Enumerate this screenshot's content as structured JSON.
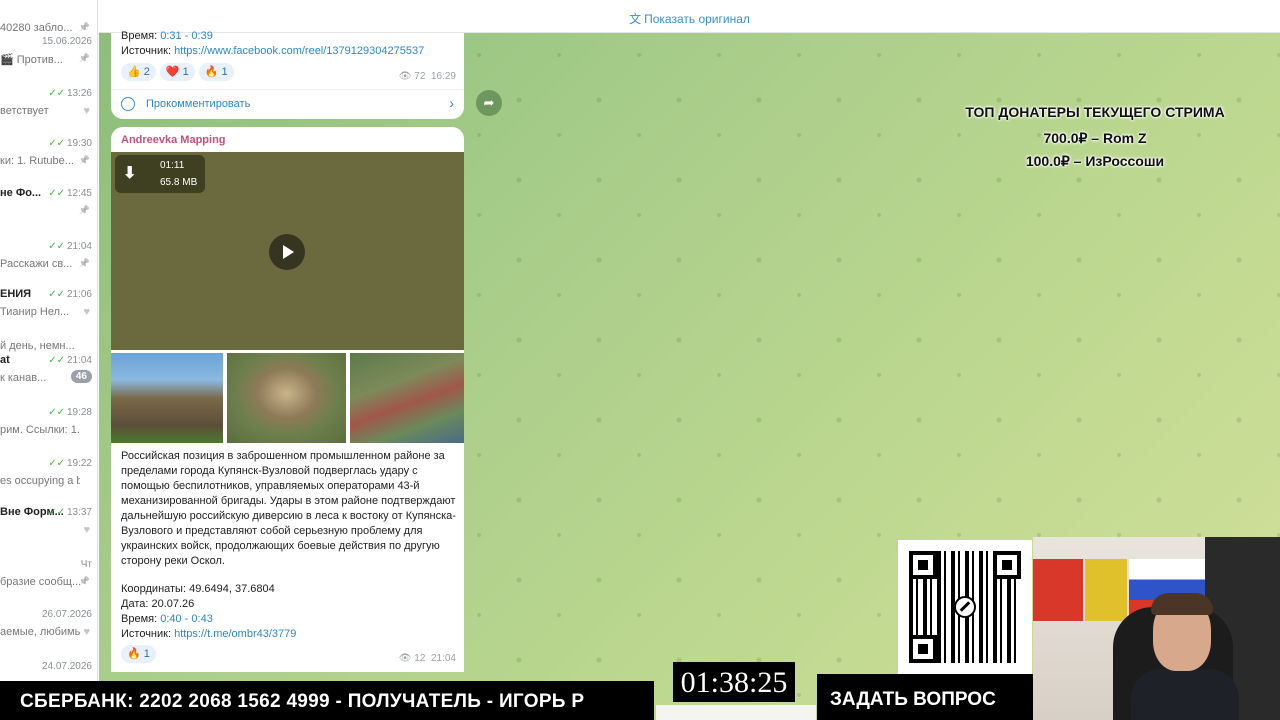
{
  "sidebar": {
    "chats": [
      {
        "name": "",
        "time": "",
        "preview": "40280 забло...",
        "icon": "pin"
      },
      {
        "name": "",
        "time": "15.06.2026",
        "preview": "🎬 Против...",
        "icon": "pin"
      },
      {
        "name": "",
        "time": "13:26",
        "preview": "ветствует",
        "icon": "heart"
      },
      {
        "name": "",
        "time": "19:30",
        "preview": "ки: 1. Rutube...",
        "icon": "pin"
      },
      {
        "name": "не Фо...",
        "time": "12:45",
        "preview": "",
        "icon": "pin"
      },
      {
        "name": "",
        "time": "21:04",
        "preview": "Расскажи св...",
        "icon": "pin"
      },
      {
        "name": "ЕНИЯ",
        "time": "21:06",
        "preview": "Тианир Нел...",
        "icon": "heart"
      },
      {
        "name": "",
        "time": "",
        "preview": "й день, немн...",
        "icon": ""
      },
      {
        "name": "at",
        "time": "21:04",
        "preview": "к канав...",
        "badge": "46"
      },
      {
        "name": "",
        "time": "19:28",
        "preview": "рим. Ссылки: 1...",
        "icon": ""
      },
      {
        "name": "",
        "time": "19:22",
        "preview": "es occupying a b...",
        "icon": ""
      },
      {
        "name": "Вне Форм...",
        "time": "13:37",
        "preview": "",
        "icon": "heart"
      },
      {
        "name": "",
        "time": "Чт",
        "preview": "бразие сообщ...",
        "icon": "pin"
      },
      {
        "name": "",
        "time": "26.07.2026",
        "preview": "аемые, любимы...",
        "icon": "heart"
      },
      {
        "name": "",
        "time": "24.07.2026",
        "preview": "",
        "icon": ""
      }
    ]
  },
  "header": {
    "show_original": "Показать оригинал"
  },
  "post1": {
    "time_label": "Время: ",
    "time_value": "0:31 - 0:39",
    "source_label": "Источник: ",
    "source_link": "https://www.facebook.com/reel/1379129304275537",
    "reactions": [
      {
        "emoji": "👍",
        "count": "2"
      },
      {
        "emoji": "❤️",
        "count": "1"
      },
      {
        "emoji": "🔥",
        "count": "1"
      }
    ],
    "views": "72",
    "time": "16:29",
    "comment_label": "Прокомментировать"
  },
  "post2": {
    "author": "Andreevka Mapping",
    "video_duration": "01:11",
    "video_size": "65.8 MB",
    "text": "Российская позиция в заброшенном промышленном районе за пределами города Купянск-Вузловой подверглась удару с помощью беспилотников, управляемых операторами 43-й механизированной бригады. Удары в этом районе подтверждают дальнейшую российскую диверсию в леса к востоку от Купянска-Вузлового и представляют собой серьезную проблему для украинских войск, продолжающих боевые действия по другую сторону реки Оскол.",
    "coords": "Координаты: 49.6494, 37.6804",
    "date": "Дата: 20.07.26",
    "time_label": "Время: ",
    "time_value": "0:40 - 0:43",
    "source_label": "Источник: ",
    "source_link": "https://t.me/ombr43/3779",
    "reaction": {
      "emoji": "🔥",
      "count": "1"
    },
    "views": "12",
    "time": "21:04"
  },
  "overlay": {
    "donaters_title": "ТОП ДОНАТЕРЫ ТЕКУЩЕГО СТРИМА",
    "donaters": [
      "700.0₽ – Rom Z",
      "100.0₽ – ИзРоссоши"
    ],
    "bank_text": "СБЕРБАНК: 2202 2068 1562 4999 - ПОЛУЧАТЕЛЬ - ИГОРЬ Р",
    "timer": "01:38:25",
    "ask_question": "ЗАДАТЬ ВОПРОС"
  }
}
